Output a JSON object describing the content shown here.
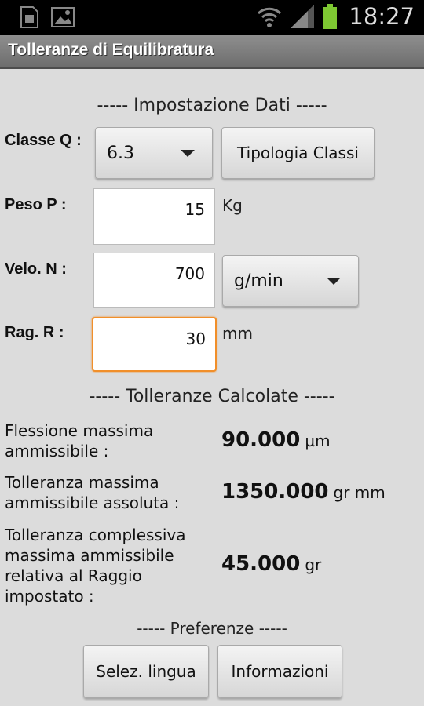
{
  "status_bar": {
    "time": "18:27",
    "left_icons": [
      "sim-icon",
      "image-icon"
    ],
    "right_icons": [
      "wifi-icon",
      "signal-icon",
      "battery-icon"
    ]
  },
  "app": {
    "title": "Tolleranze di Equilibratura"
  },
  "input_section": {
    "header": "----- Impostazione Dati -----",
    "classe": {
      "label": "Classe Q :",
      "value": "6.3",
      "button": "Tipologia Classi"
    },
    "peso": {
      "label": "Peso P :",
      "value": "15",
      "unit": "Kg"
    },
    "velo": {
      "label": "Velo. N :",
      "value": "700",
      "unit_select": "g/min"
    },
    "raggio": {
      "label": "Rag. R :",
      "value": "30",
      "unit": "mm"
    }
  },
  "results_section": {
    "header": "----- Tolleranze Calcolate -----",
    "rows": [
      {
        "label": "Flessione massima ammissibile :",
        "value": "90.000",
        "unit": "µm"
      },
      {
        "label": "Tolleranza massima ammissibile assoluta :",
        "value": "1350.000",
        "unit": "gr mm"
      },
      {
        "label": "Tolleranza complessiva massima ammissibile relativa al Raggio impostato :",
        "value": "45.000",
        "unit": "gr"
      }
    ]
  },
  "preferences": {
    "header": "----- Preferenze -----",
    "language_button": "Selez. lingua",
    "info_button": "Informazioni"
  },
  "colors": {
    "focus": "#f18f2a",
    "background": "#dcdcdc",
    "battery": "#7ec832"
  }
}
